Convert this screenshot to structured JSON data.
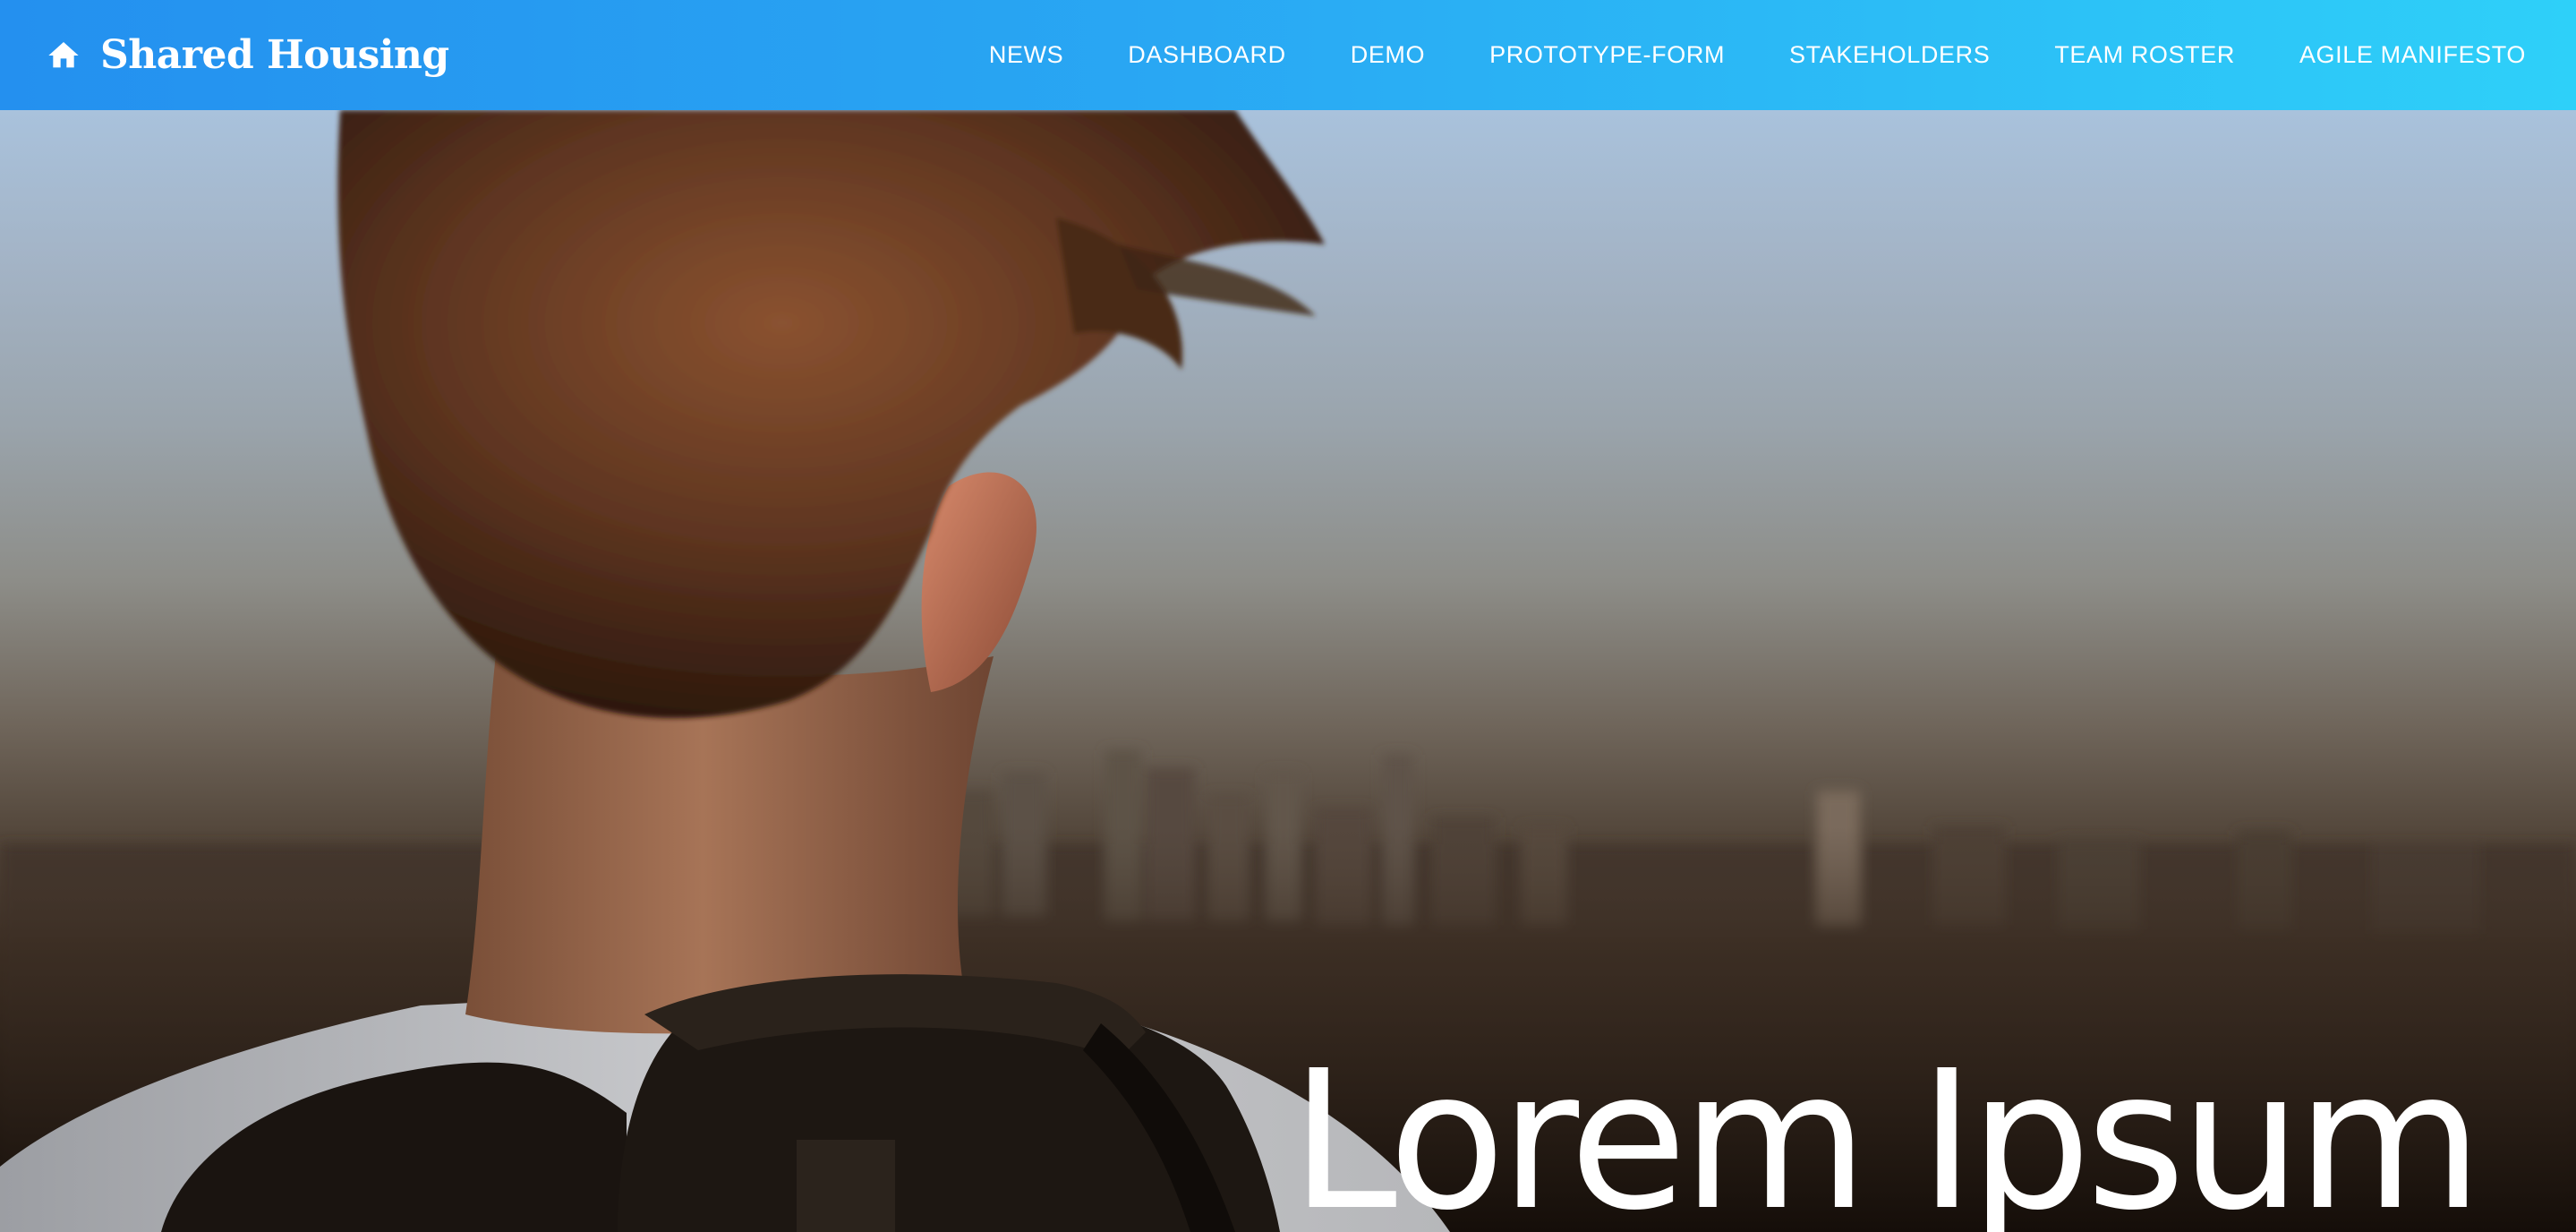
{
  "navbar": {
    "brand": {
      "icon": "home-icon",
      "title": "Shared Housing"
    },
    "links": [
      {
        "label": "NEWS"
      },
      {
        "label": "DASHBOARD"
      },
      {
        "label": "DEMO"
      },
      {
        "label": "PROTOTYPE-FORM"
      },
      {
        "label": "STAKEHOLDERS"
      },
      {
        "label": "TEAM ROSTER"
      },
      {
        "label": "AGILE MANIFESTO"
      }
    ],
    "colors": {
      "gradient_start": "#2490ef",
      "gradient_end": "#2ed0f9",
      "text": "#ffffff"
    }
  },
  "hero": {
    "heading": "Lorem Ipsum"
  }
}
